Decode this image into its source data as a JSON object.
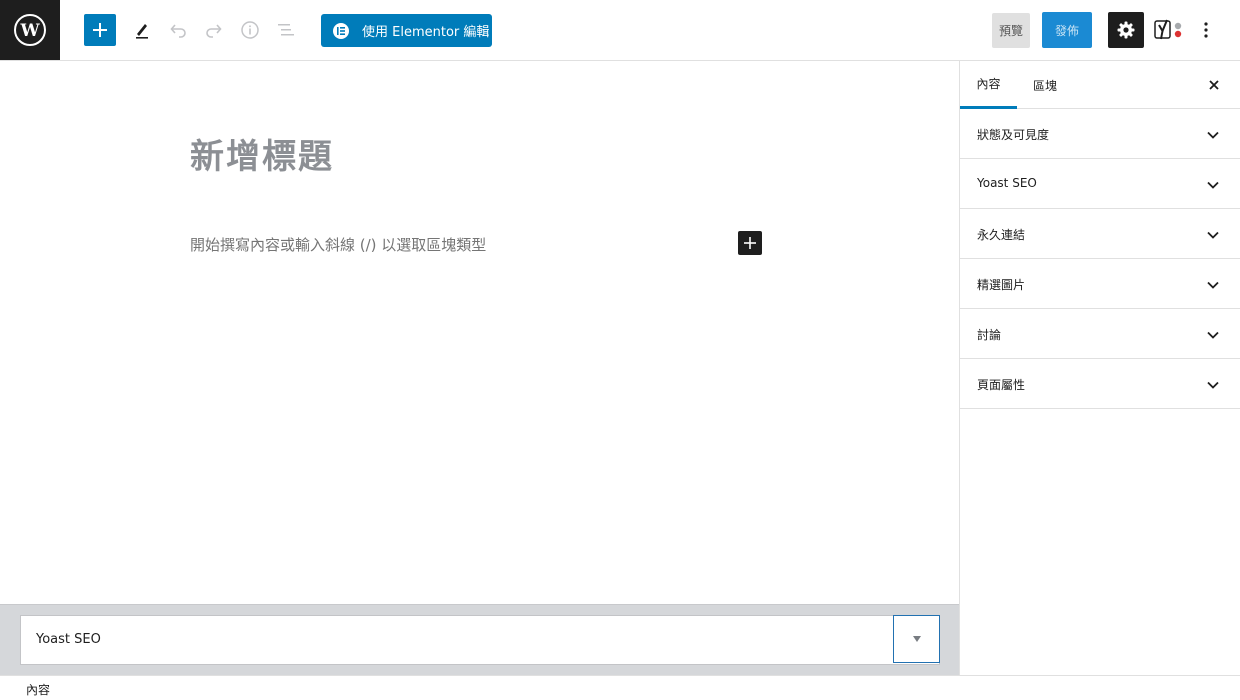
{
  "toolbar": {
    "elementor_label": "使用 Elementor 編輯",
    "preview_label": "預覽",
    "publish_label": "發佈"
  },
  "editor": {
    "title_placeholder": "新增標題",
    "block_placeholder": "開始撰寫內容或輸入斜線 (/) 以選取區塊類型"
  },
  "sidebar": {
    "tabs": [
      {
        "label": "內容"
      },
      {
        "label": "區塊"
      }
    ],
    "panels": [
      {
        "label": "狀態及可見度"
      },
      {
        "label": "Yoast SEO"
      },
      {
        "label": "永久連結"
      },
      {
        "label": "精選圖片"
      },
      {
        "label": "討論"
      },
      {
        "label": "頁面屬性"
      }
    ]
  },
  "metabox": {
    "title": "Yoast SEO"
  },
  "footer": {
    "breadcrumb": "內容"
  },
  "colors": {
    "accent": "#007cba",
    "dark": "#1e1e1e"
  }
}
